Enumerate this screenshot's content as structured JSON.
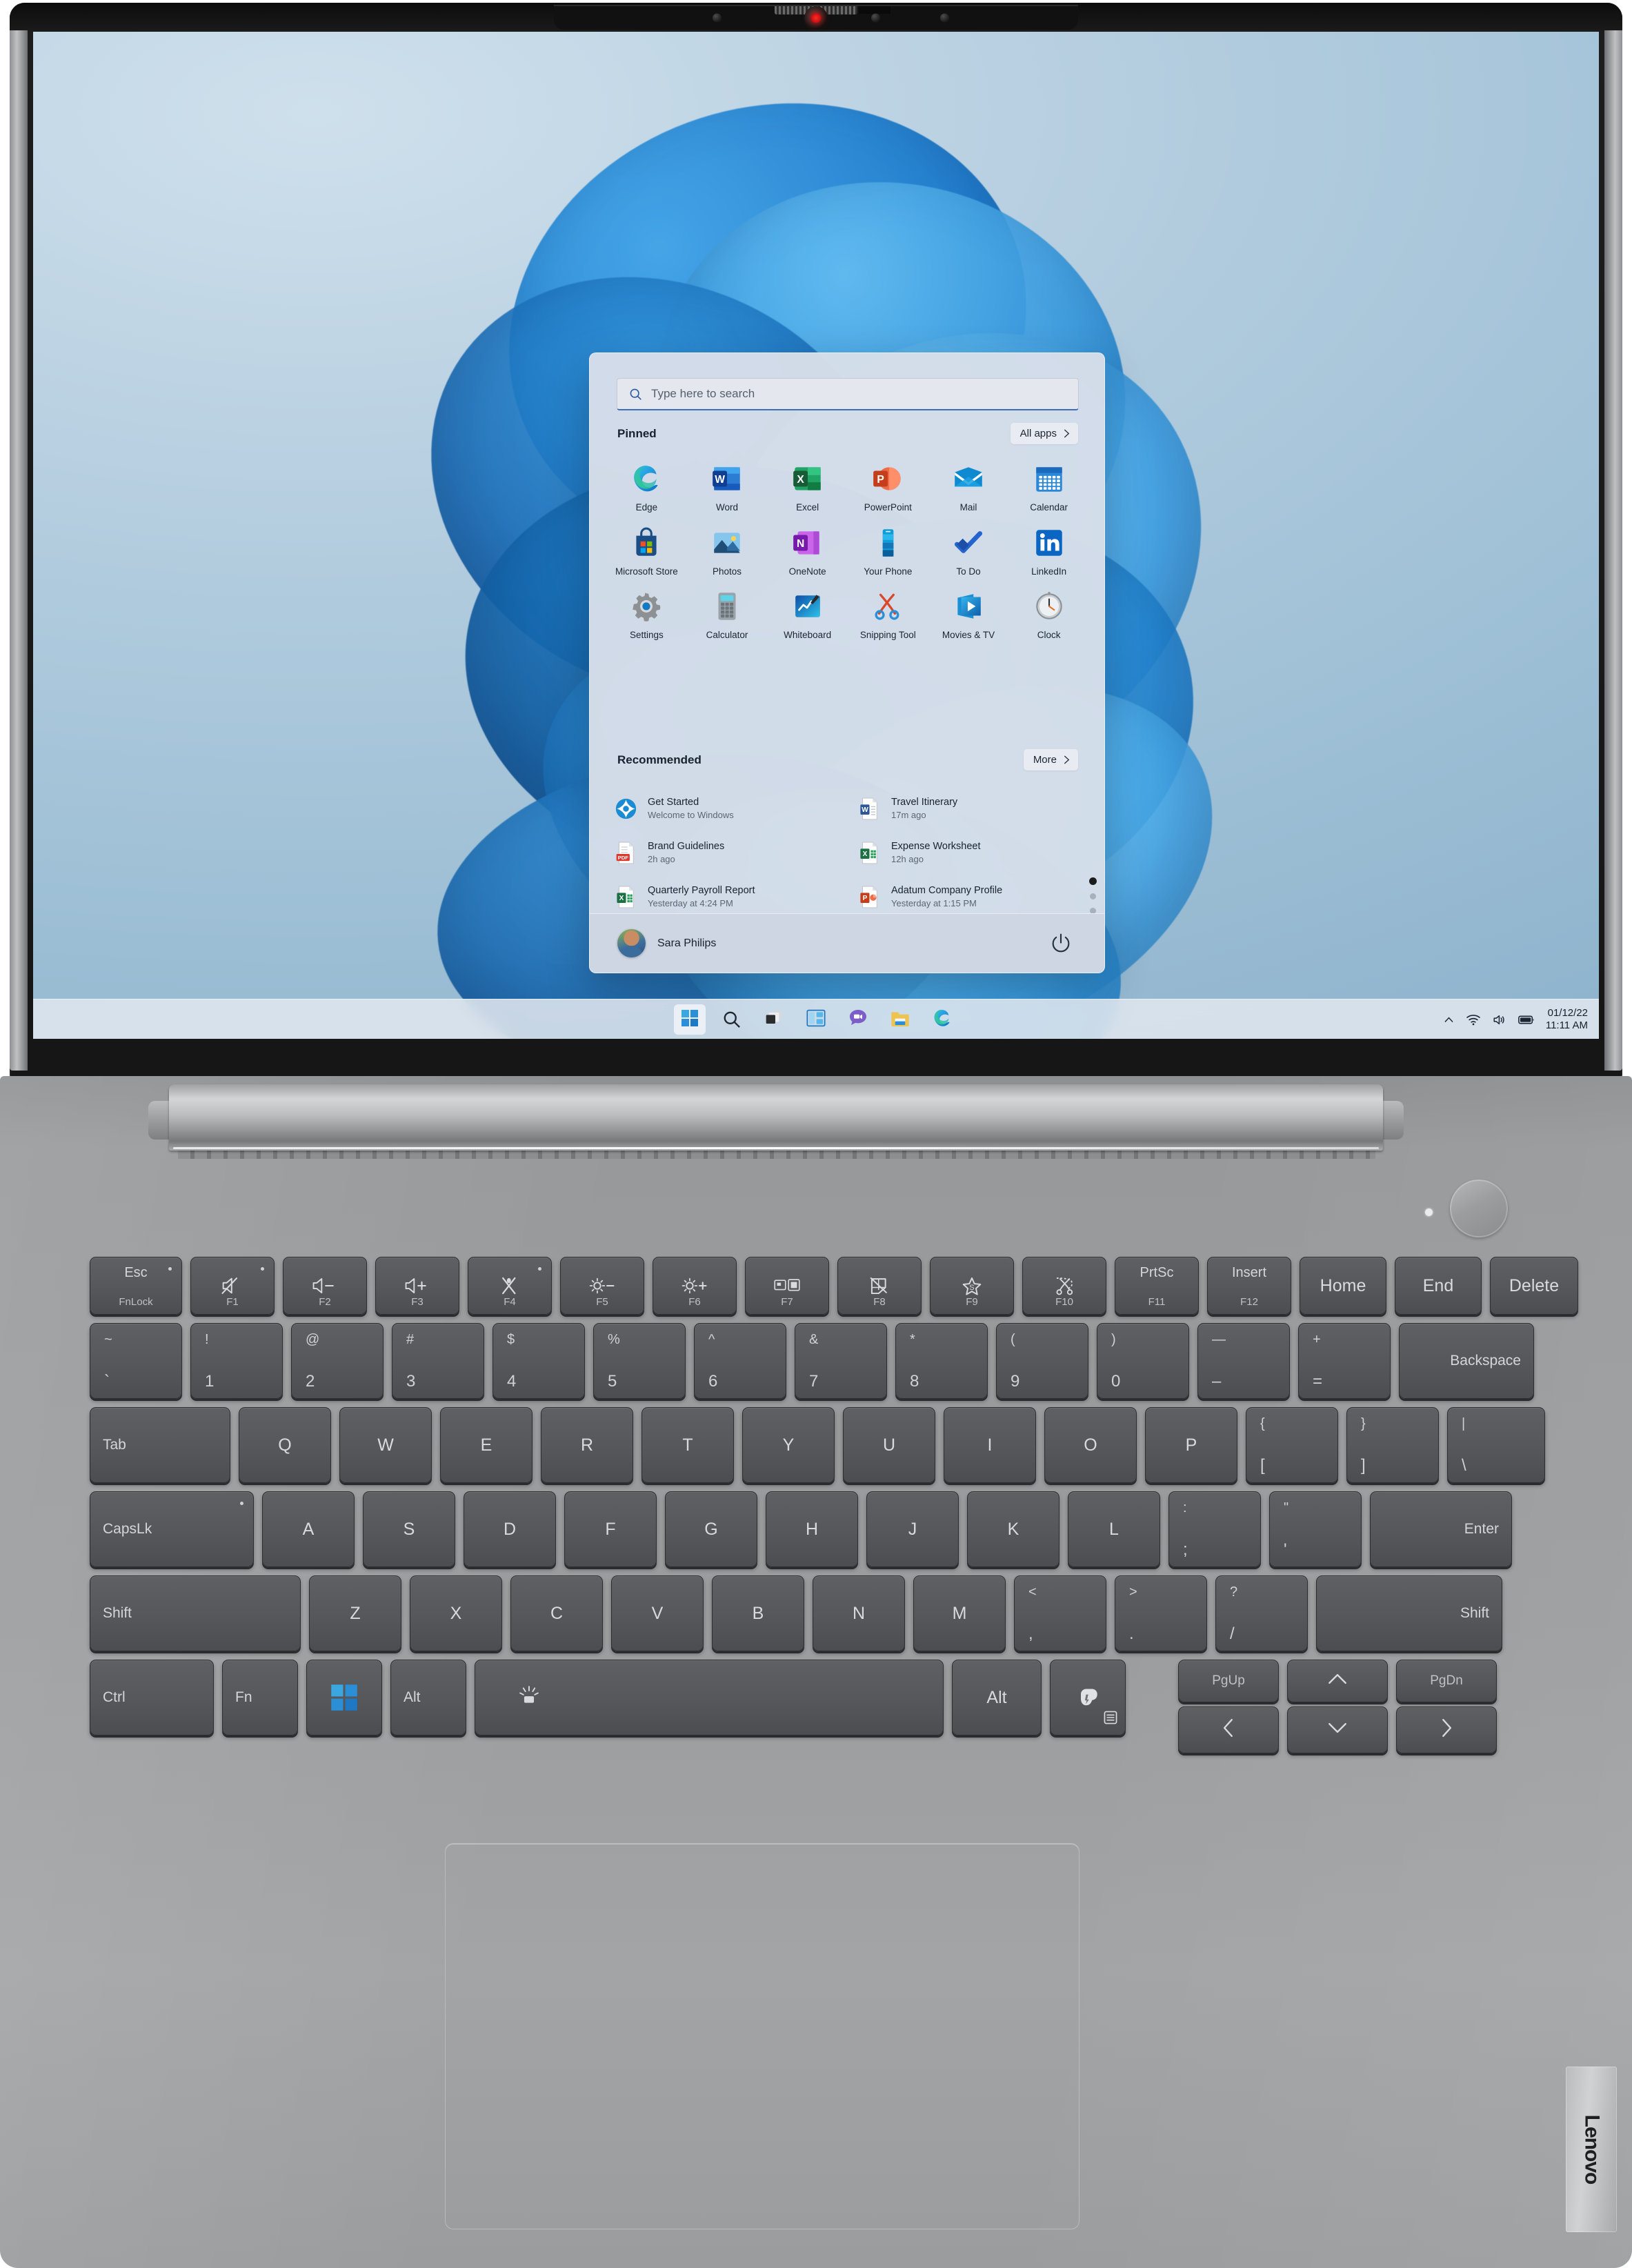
{
  "device": {
    "brand": "Lenovo"
  },
  "search": {
    "placeholder": "Type here to search",
    "icon": "search-icon"
  },
  "start": {
    "pinned_heading": "Pinned",
    "all_apps_label": "All apps",
    "recommended_heading": "Recommended",
    "more_label": "More",
    "pinned": [
      {
        "label": "Edge",
        "icon": "edge-icon"
      },
      {
        "label": "Word",
        "icon": "word-icon"
      },
      {
        "label": "Excel",
        "icon": "excel-icon"
      },
      {
        "label": "PowerPoint",
        "icon": "powerpoint-icon"
      },
      {
        "label": "Mail",
        "icon": "mail-icon"
      },
      {
        "label": "Calendar",
        "icon": "calendar-icon"
      },
      {
        "label": "Microsoft Store",
        "icon": "store-icon"
      },
      {
        "label": "Photos",
        "icon": "photos-icon"
      },
      {
        "label": "OneNote",
        "icon": "onenote-icon"
      },
      {
        "label": "Your Phone",
        "icon": "phone-icon"
      },
      {
        "label": "To Do",
        "icon": "todo-icon"
      },
      {
        "label": "LinkedIn",
        "icon": "linkedin-icon"
      },
      {
        "label": "Settings",
        "icon": "gear-icon"
      },
      {
        "label": "Calculator",
        "icon": "calculator-icon"
      },
      {
        "label": "Whiteboard",
        "icon": "whiteboard-icon"
      },
      {
        "label": "Snipping Tool",
        "icon": "scissors-icon"
      },
      {
        "label": "Movies & TV",
        "icon": "movies-icon"
      },
      {
        "label": "Clock",
        "icon": "clock-icon"
      }
    ],
    "page_dots": 3,
    "active_page": 1,
    "recommended": [
      {
        "title": "Get Started",
        "subtitle": "Welcome to Windows",
        "icon": "get-started-icon"
      },
      {
        "title": "Travel Itinerary",
        "subtitle": "17m ago",
        "icon": "word-doc-icon"
      },
      {
        "title": "Brand Guidelines",
        "subtitle": "2h ago",
        "icon": "pdf-doc-icon"
      },
      {
        "title": "Expense Worksheet",
        "subtitle": "12h ago",
        "icon": "excel-doc-icon"
      },
      {
        "title": "Quarterly Payroll Report",
        "subtitle": "Yesterday at 4:24 PM",
        "icon": "excel-doc-icon"
      },
      {
        "title": "Adatum Company Profile",
        "subtitle": "Yesterday at 1:15 PM",
        "icon": "ppt-doc-icon"
      }
    ],
    "user": {
      "name": "Sara Philips",
      "avatar": "user-avatar",
      "power": "power-icon"
    }
  },
  "taskbar": {
    "items": [
      {
        "name": "start-button",
        "icon": "windows-logo-icon",
        "active": true
      },
      {
        "name": "search-button",
        "icon": "search-icon",
        "active": false
      },
      {
        "name": "task-view-button",
        "icon": "task-view-icon",
        "active": false
      },
      {
        "name": "widgets-button",
        "icon": "widgets-icon",
        "active": false
      },
      {
        "name": "chat-button",
        "icon": "chat-icon",
        "active": false
      },
      {
        "name": "file-explorer-button",
        "icon": "folder-icon",
        "active": false
      },
      {
        "name": "edge-button",
        "icon": "edge-icon",
        "active": false
      }
    ],
    "tray": {
      "chevron": "chevron-up-icon",
      "wifi": "wifi-icon",
      "volume": "speaker-icon",
      "battery": "battery-icon",
      "date": "01/12/22",
      "time": "11:11 AM"
    }
  },
  "keyboard": {
    "function_row": [
      {
        "main": "Esc",
        "sub": "FnLock",
        "wide": 150,
        "type": "text-dual",
        "led": true
      },
      {
        "main": "mute-icon",
        "sub": "F1",
        "wide": 126,
        "type": "icon",
        "led": true
      },
      {
        "main": "volume-down-icon",
        "sub": "F2",
        "wide": 126,
        "type": "icon"
      },
      {
        "main": "volume-up-icon",
        "sub": "F3",
        "wide": 126,
        "type": "icon"
      },
      {
        "main": "mic-mute-icon",
        "sub": "F4",
        "wide": 126,
        "type": "icon",
        "led": true
      },
      {
        "main": "brightness-down-icon",
        "sub": "F5",
        "wide": 126,
        "type": "icon"
      },
      {
        "main": "brightness-up-icon",
        "sub": "F6",
        "wide": 126,
        "type": "icon"
      },
      {
        "main": "display-switch-icon",
        "sub": "F7",
        "wide": 126,
        "type": "icon"
      },
      {
        "main": "airplane-icon",
        "sub": "F8",
        "wide": 126,
        "type": "icon"
      },
      {
        "main": "star-icon",
        "sub": "F9",
        "wide": 126,
        "type": "icon"
      },
      {
        "main": "snip-icon",
        "sub": "F10",
        "wide": 126,
        "type": "icon"
      },
      {
        "main": "PrtSc",
        "sub": "F11",
        "wide": 126,
        "type": "text-dual"
      },
      {
        "main": "Insert",
        "sub": "F12",
        "wide": 126,
        "type": "text-dual"
      },
      {
        "main": "Home",
        "sub": "",
        "wide": 126,
        "type": "text"
      },
      {
        "main": "End",
        "sub": "",
        "wide": 126,
        "type": "text"
      },
      {
        "main": "Delete",
        "sub": "",
        "wide": 126,
        "type": "text"
      }
    ],
    "number_row": [
      {
        "top": "~",
        "bot": "`",
        "wide": 134
      },
      {
        "top": "!",
        "bot": "1",
        "wide": 134
      },
      {
        "top": "@",
        "bot": "2",
        "wide": 134
      },
      {
        "top": "#",
        "bot": "3",
        "wide": 134
      },
      {
        "top": "$",
        "bot": "4",
        "wide": 134
      },
      {
        "top": "%",
        "bot": "5",
        "wide": 134
      },
      {
        "top": "^",
        "bot": "6",
        "wide": 134
      },
      {
        "top": "&",
        "bot": "7",
        "wide": 134
      },
      {
        "top": "*",
        "bot": "8",
        "wide": 134
      },
      {
        "top": "(",
        "bot": "9",
        "wide": 134
      },
      {
        "top": ")",
        "bot": "0",
        "wide": 134
      },
      {
        "top": "—",
        "bot": "–",
        "wide": 134
      },
      {
        "top": "+",
        "bot": "=",
        "wide": 134
      },
      {
        "label": "Backspace",
        "wide": 196,
        "align": "right"
      }
    ],
    "tab_row": [
      {
        "label": "Tab",
        "wide": 204,
        "align": "left"
      },
      {
        "label": "Q",
        "wide": 134
      },
      {
        "label": "W",
        "wide": 134
      },
      {
        "label": "E",
        "wide": 134
      },
      {
        "label": "R",
        "wide": 134
      },
      {
        "label": "T",
        "wide": 134
      },
      {
        "label": "Y",
        "wide": 134
      },
      {
        "label": "U",
        "wide": 134
      },
      {
        "label": "I",
        "wide": 134
      },
      {
        "label": "O",
        "wide": 134
      },
      {
        "label": "P",
        "wide": 134
      },
      {
        "top": "{",
        "bot": "[",
        "wide": 134
      },
      {
        "top": "}",
        "bot": "]",
        "wide": 134
      },
      {
        "top": "|",
        "bot": "\\",
        "wide": 142
      }
    ],
    "caps_row": [
      {
        "label": "CapsLk",
        "wide": 238,
        "align": "left",
        "led": true
      },
      {
        "label": "A",
        "wide": 134
      },
      {
        "label": "S",
        "wide": 134
      },
      {
        "label": "D",
        "wide": 134
      },
      {
        "label": "F",
        "wide": 134
      },
      {
        "label": "G",
        "wide": 134
      },
      {
        "label": "H",
        "wide": 134
      },
      {
        "label": "J",
        "wide": 134
      },
      {
        "label": "K",
        "wide": 134
      },
      {
        "label": "L",
        "wide": 134
      },
      {
        "top": ":",
        "bot": ";",
        "wide": 134
      },
      {
        "top": "\"",
        "bot": "'",
        "wide": 134
      },
      {
        "label": "Enter",
        "wide": 206,
        "align": "right"
      }
    ],
    "shift_row": [
      {
        "label": "Shift",
        "wide": 306,
        "align": "left"
      },
      {
        "label": "Z",
        "wide": 134
      },
      {
        "label": "X",
        "wide": 134
      },
      {
        "label": "C",
        "wide": 134
      },
      {
        "label": "V",
        "wide": 134
      },
      {
        "label": "B",
        "wide": 134
      },
      {
        "label": "N",
        "wide": 134
      },
      {
        "label": "M",
        "wide": 134
      },
      {
        "top": "<",
        "bot": ",",
        "wide": 134
      },
      {
        "top": ">",
        "bot": ".",
        "wide": 134
      },
      {
        "top": "?",
        "bot": "/",
        "wide": 134
      },
      {
        "label": "Shift",
        "wide": 270,
        "align": "right"
      }
    ],
    "bottom_row": [
      {
        "label": "Ctrl",
        "wide": 180,
        "align": "left"
      },
      {
        "label": "Fn",
        "wide": 134,
        "align": "left"
      },
      {
        "label": "windows-logo-icon",
        "wide": 134,
        "type": "icon"
      },
      {
        "label": "Alt",
        "wide": 122,
        "align": "left"
      },
      {
        "label": "backlight-icon",
        "wide": 672,
        "type": "icon-space"
      },
      {
        "label": "Alt",
        "wide": 134
      },
      {
        "label": "copilot-icon",
        "wide": 120,
        "type": "icon"
      }
    ],
    "nav_keys": {
      "pgup": "PgUp",
      "pgdn": "PgDn",
      "up": "arrow-up-icon",
      "down": "arrow-down-icon",
      "left": "arrow-left-icon",
      "right": "arrow-right-icon"
    }
  }
}
